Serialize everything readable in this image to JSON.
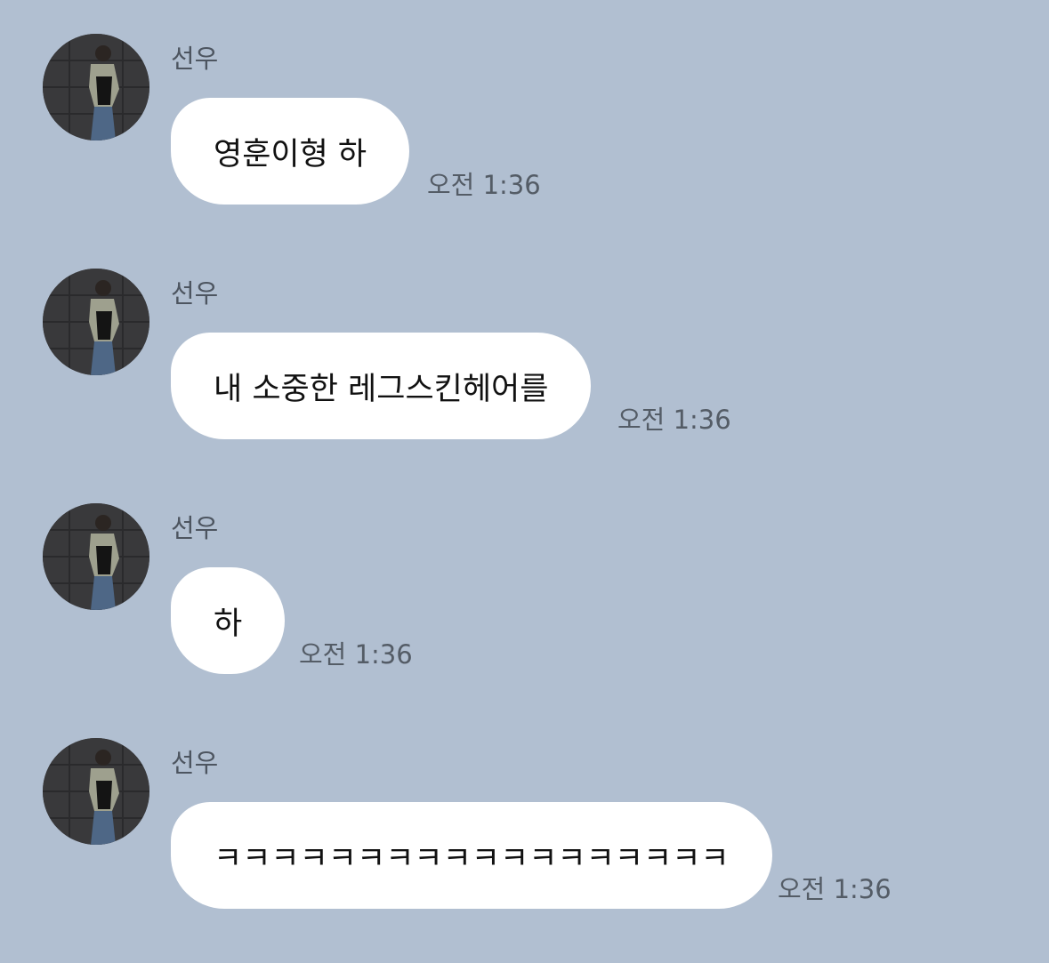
{
  "chat": {
    "messages": [
      {
        "sender": "선우",
        "text": "영훈이형 하",
        "time": "오전 1:36"
      },
      {
        "sender": "선우",
        "text": "내 소중한 레그스킨헤어를",
        "time": "오전 1:36"
      },
      {
        "sender": "선우",
        "text": "하",
        "time": "오전 1:36"
      },
      {
        "sender": "선우",
        "text": "ㅋㅋㅋㅋㅋㅋㅋㅋㅋㅋㅋㅋㅋㅋㅋㅋㅋㅋ",
        "time": "오전 1:36"
      }
    ]
  },
  "colors": {
    "background": "#b1bfd1",
    "bubble": "#ffffff",
    "sender_text": "#4d5560",
    "time_text": "#545c66"
  }
}
